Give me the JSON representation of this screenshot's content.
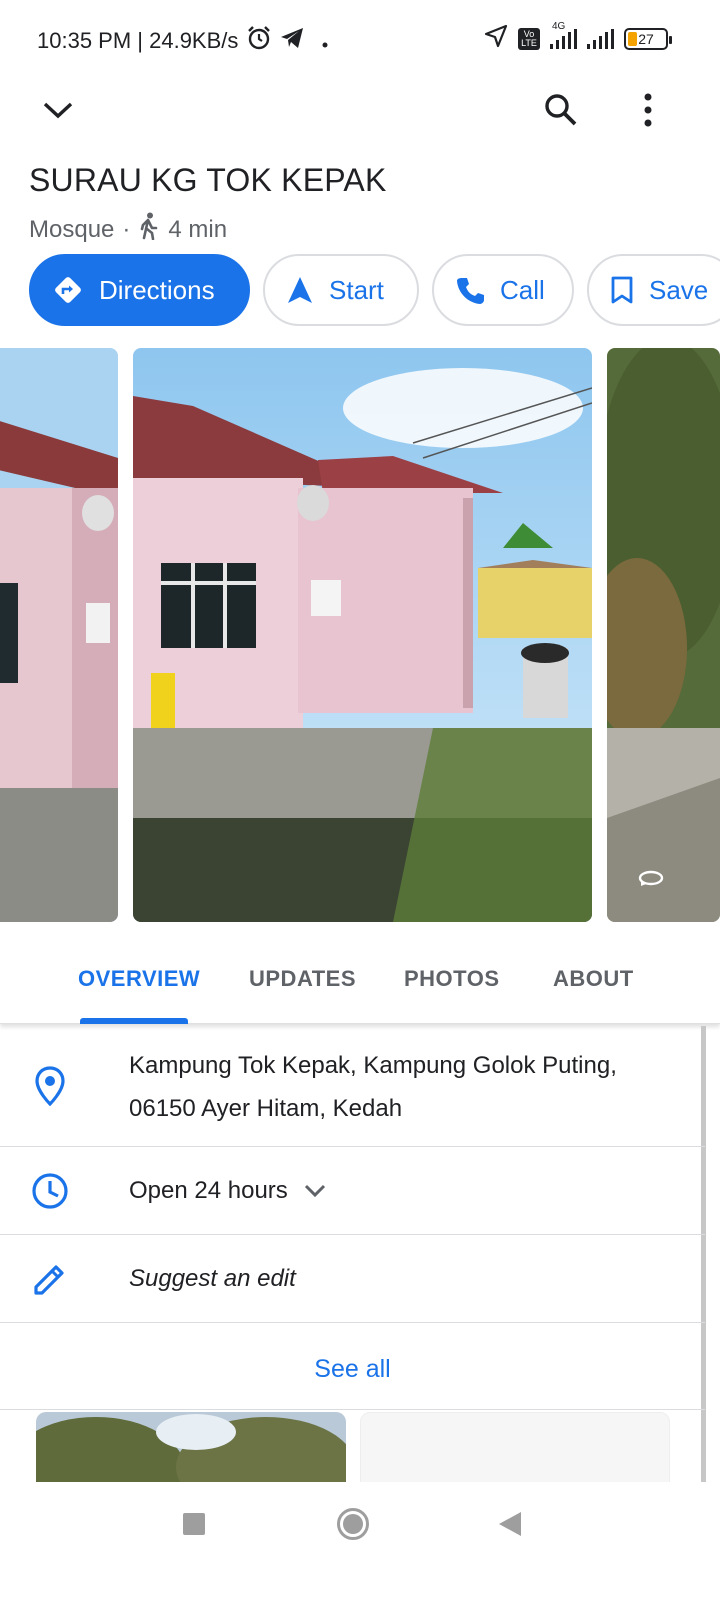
{
  "status_bar": {
    "time_speed": "10:35 PM | 24.9KB/s",
    "network_label": "4G",
    "volte_label": "Vo LTE",
    "battery": "27"
  },
  "place": {
    "name": "SURAU KG TOK KEPAK",
    "category": "Mosque",
    "separator": "·",
    "walk_time": "4 min"
  },
  "actions": {
    "directions": "Directions",
    "start": "Start",
    "call": "Call",
    "save": "Save"
  },
  "tabs": [
    "OVERVIEW",
    "UPDATES",
    "PHOTOS",
    "ABOUT"
  ],
  "details": {
    "address_line1": "Kampung Tok Kepak, Kampung Golok Puting,",
    "address_line2": "06150 Ayer Hitam, Kedah",
    "hours": "Open 24 hours",
    "suggest_edit": "Suggest an edit",
    "see_all": "See all"
  },
  "colors": {
    "accent": "#1a73e8",
    "open_green": "#188038",
    "secondary_text": "#5f6368"
  }
}
